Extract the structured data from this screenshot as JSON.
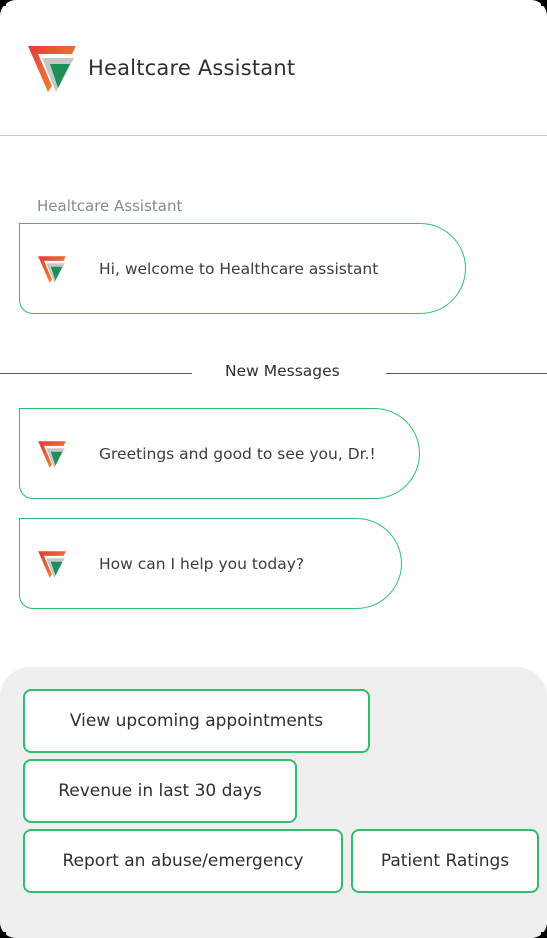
{
  "header": {
    "title": "Healtcare Assistant",
    "logo_icon": "brand-logo-icon"
  },
  "chat": {
    "sender_label": "Healtcare Assistant",
    "messages": [
      {
        "text": "Hi, welcome to Healthcare assistant",
        "icon": "bot-avatar-icon"
      }
    ],
    "new_messages_divider": "New Messages",
    "new_messages": [
      {
        "text": "Greetings and good to see you, Dr.!",
        "icon": "bot-avatar-icon"
      },
      {
        "text": "How can I help you today?",
        "icon": "bot-avatar-icon"
      }
    ]
  },
  "quick_replies": [
    "View upcoming appointments",
    "Revenue in last 30 days",
    "Report an abuse/emergency",
    "Patient Ratings"
  ],
  "colors": {
    "accent_green": "#2fbf6a",
    "logo_orange": "#ef6a2b",
    "logo_red": "#e23b3b",
    "panel_gray": "#efefef"
  }
}
